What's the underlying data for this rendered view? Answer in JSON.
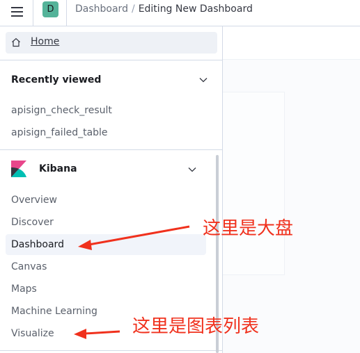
{
  "header": {
    "space_initial": "D",
    "breadcrumbs": [
      "Dashboard",
      "Editing New Dashboard"
    ],
    "breadcrumb_separator": "/"
  },
  "nav": {
    "home_label": "Home",
    "recently_viewed": {
      "title": "Recently viewed",
      "items": [
        "apisign_check_result",
        "apisign_failed_table"
      ]
    },
    "kibana": {
      "title": "Kibana",
      "items": [
        "Overview",
        "Discover",
        "Dashboard",
        "Canvas",
        "Maps",
        "Machine Learning",
        "Visualize"
      ],
      "active_item": "Dashboard"
    }
  },
  "annotations": {
    "dashboard_note": "这里是大盘",
    "visualize_note": "这里是图表列表",
    "color": "#f0311d"
  },
  "colors": {
    "space_avatar": "#54b399",
    "kibana_logo_pink": "#e8478b",
    "kibana_logo_teal": "#00bfb3",
    "kibana_logo_dark": "#343741"
  }
}
